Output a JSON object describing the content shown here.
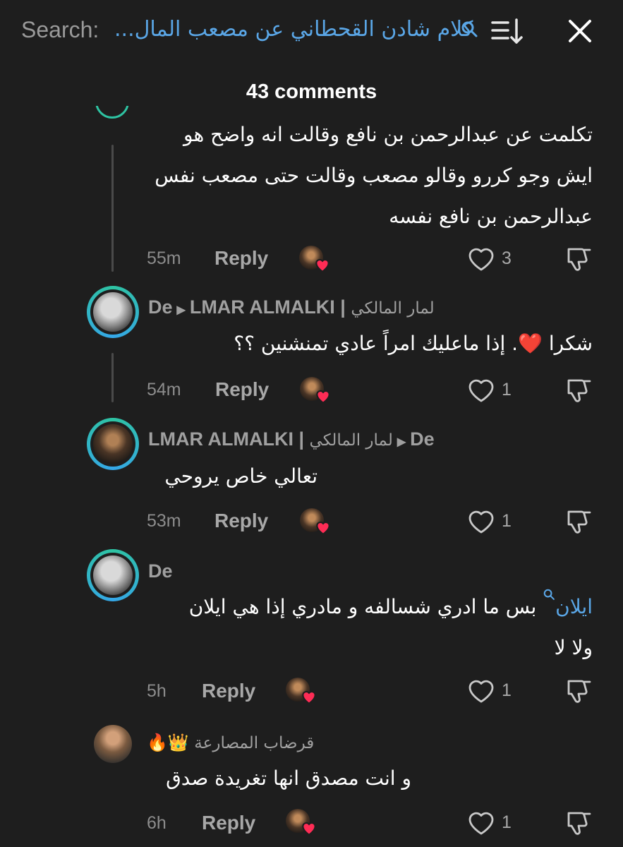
{
  "search": {
    "prefix": "Search:",
    "query": "كلام شادن القحطاني عن مصعب المال..."
  },
  "header": {
    "comments_count": "43 comments"
  },
  "comments": [
    {
      "lines": [
        "تكلمت عن عبدالرحمن بن نافع وقالت انه واضح هو",
        "ايش وجو كررو وقالو مصعب وقالت حتى مصعب نفس",
        "عبدالرحمن بن نافع نفسه"
      ],
      "time": "55m",
      "reply": "Reply",
      "likes": "3"
    },
    {
      "user_latin": "De",
      "user_target": "LMAR ALMALKI |",
      "user_target_ar": "لمار المالكي",
      "text": "شكرا ❤️. إذا ماعليك امراً عادي تمنشنين ؟؟",
      "time": "54m",
      "reply": "Reply",
      "likes": "1"
    },
    {
      "user_latin": "LMAR ALMALKI |",
      "user_ar": "لمار المالكي",
      "user_target": "De",
      "text": "تعالي خاص يروحي",
      "time": "53m",
      "reply": "Reply",
      "likes": "1"
    },
    {
      "user_latin": "De",
      "mention": "ايلان",
      "lines": [
        "بس ما ادري شسالفه و مادري إذا هي ايلان",
        "ولا لا"
      ],
      "time": "5h",
      "reply": "Reply",
      "likes": "1"
    },
    {
      "user_ar": "قرضاب المصارعة",
      "user_emoji": "🔥👑",
      "text": "و انت مصدق انها تغريدة صدق",
      "time": "6h",
      "reply": "Reply",
      "likes": "1"
    }
  ],
  "colors": {
    "background": "#1e1e1e",
    "accent_blue": "#5aa6e6",
    "ring_teal": "#2ec3a2",
    "heart_red": "#fe2c55"
  }
}
